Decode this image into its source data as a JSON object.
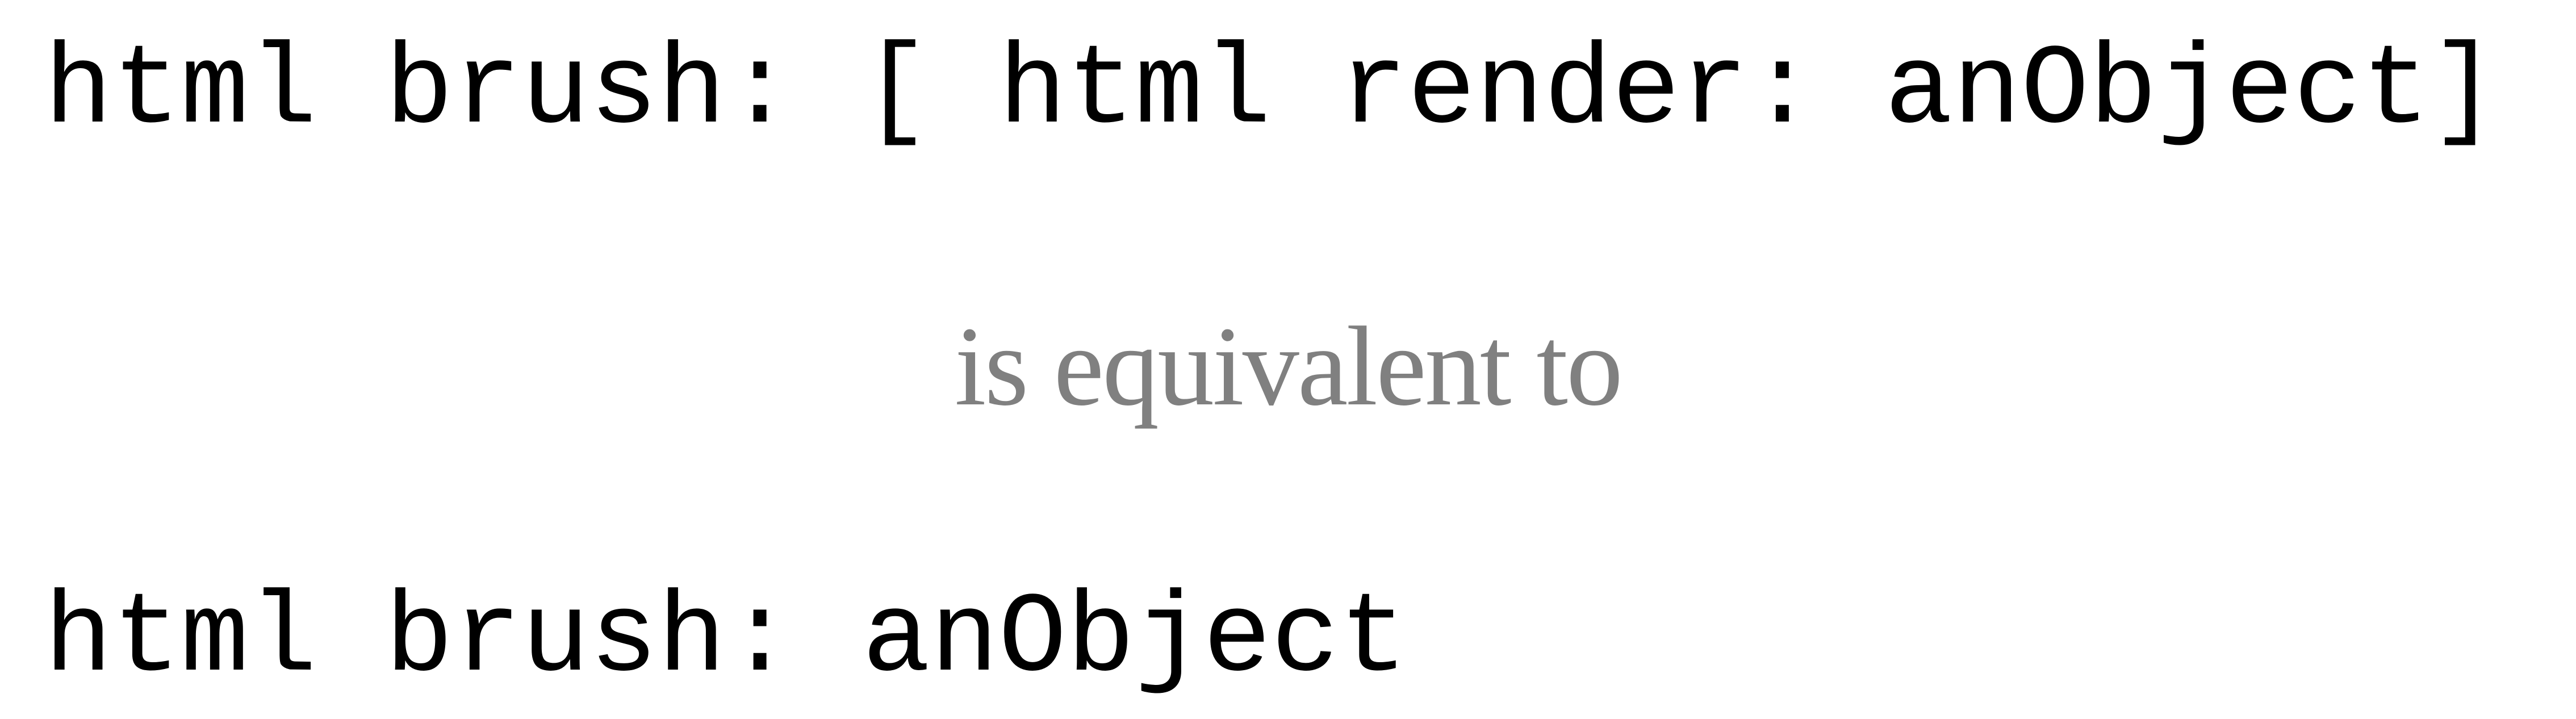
{
  "document": {
    "code_line_1": "html brush: [ html render: anObject]",
    "caption": "is equivalent to",
    "code_line_2": "html brush: anObject"
  },
  "colors": {
    "code_text": "#000000",
    "caption_text": "#808080",
    "background": "#ffffff"
  }
}
